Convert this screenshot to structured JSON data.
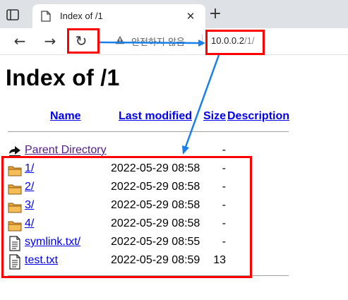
{
  "browser": {
    "tab_title": "Index of /1",
    "tab_close_glyph": "✕",
    "new_tab_glyph": "+",
    "back_glyph": "←",
    "forward_glyph": "→",
    "reload_glyph": "↻",
    "security_text": "안전하지 않음",
    "url_host": "10.0.0.2",
    "url_path": "/1/"
  },
  "page": {
    "title": "Index of /1",
    "columns": {
      "name": "Name",
      "last_modified": "Last modified",
      "size": "Size",
      "description": "Description"
    },
    "parent": {
      "label": "Parent Directory",
      "size": "-"
    },
    "entries": [
      {
        "name": "1/",
        "modified": "2022-05-29 08:58",
        "size": "-",
        "icon": "folder-icon"
      },
      {
        "name": "2/",
        "modified": "2022-05-29 08:58",
        "size": "-",
        "icon": "folder-icon"
      },
      {
        "name": "3/",
        "modified": "2022-05-29 08:58",
        "size": "-",
        "icon": "folder-icon"
      },
      {
        "name": "4/",
        "modified": "2022-05-29 08:58",
        "size": "-",
        "icon": "folder-icon"
      },
      {
        "name": "symlink.txt/",
        "modified": "2022-05-29 08:55",
        "size": "-",
        "icon": "text-file-icon"
      },
      {
        "name": "test.txt",
        "modified": "2022-05-29 08:59",
        "size": "13",
        "icon": "text-file-icon"
      }
    ]
  },
  "colors": {
    "annotation_box": "#ff0000",
    "annotation_arrow": "#1a7fe8",
    "link": "#0000ee",
    "visited_link": "#551a8b"
  }
}
